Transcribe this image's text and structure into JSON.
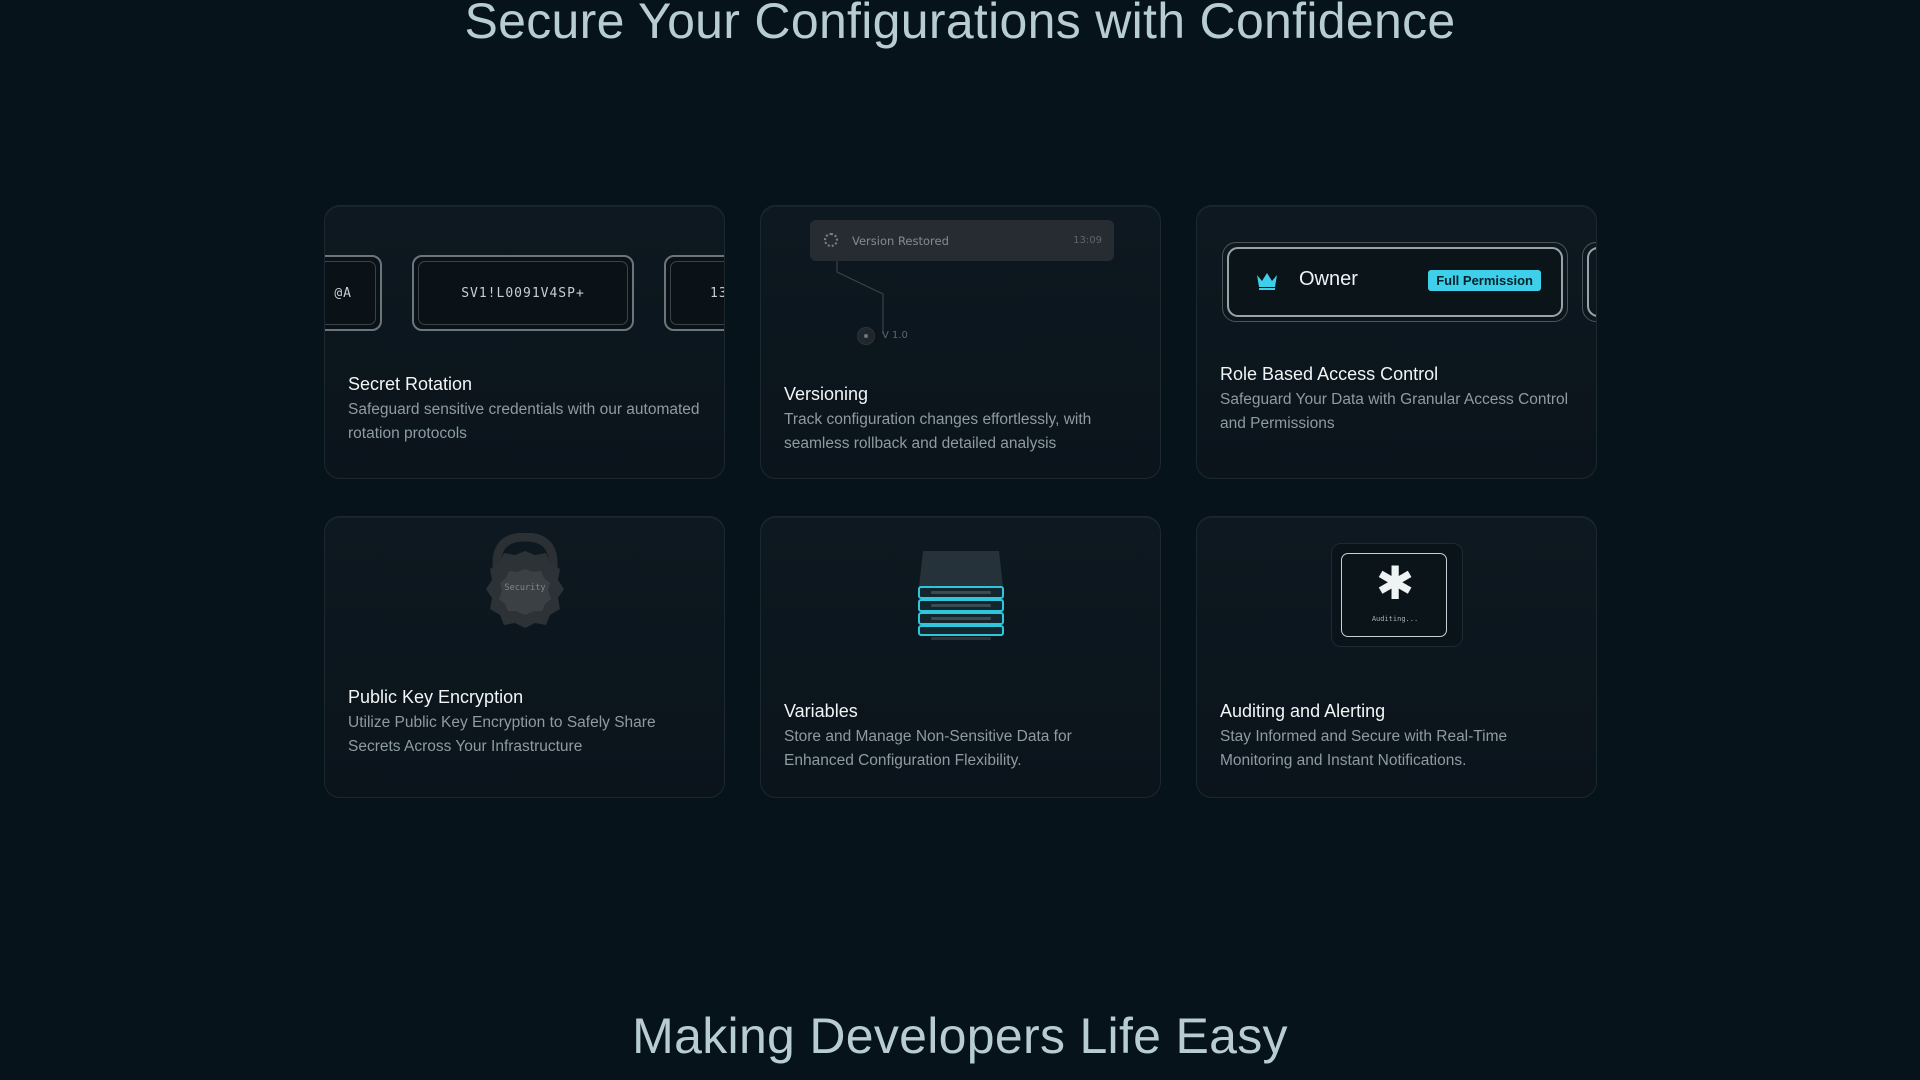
{
  "header": {
    "title": "Secure Your Configurations with Confidence"
  },
  "footer": {
    "title": "Making Developers Life Easy"
  },
  "cards": [
    {
      "title": "Secret Rotation",
      "description": "Safeguard sensitive credentials with our automated rotation protocols",
      "secrets": [
        "@A",
        "SV1!L0091V4SP+",
        "13"
      ]
    },
    {
      "title": "Versioning",
      "description": "Track configuration changes effortlessly, with seamless rollback and detailed analysis",
      "status": "Version Restored",
      "time": "13:09",
      "version": "V 1.0"
    },
    {
      "title": "Role Based Access Control",
      "description": "Safeguard Your Data with Granular Access Control and Permissions",
      "role": "Owner",
      "badge": "Full Permission"
    },
    {
      "title": "Public Key Encryption",
      "description": "Utilize Public Key Encryption to Safely Share Secrets Across Your Infrastructure",
      "lock_label": "Security"
    },
    {
      "title": "Variables",
      "description": "Store and Manage Non-Sensitive Data for Enhanced Configuration Flexibility."
    },
    {
      "title": "Auditing and Alerting",
      "description": "Stay Informed and Secure with Real-Time Monitoring and Instant Notifications.",
      "audit_label": "Auditing..."
    }
  ],
  "colors": {
    "accent": "#3ed0ea",
    "background": "#06131a",
    "card": "#0d1820"
  },
  "icons": [
    "spinner-icon",
    "crown-icon",
    "lock-icon",
    "stack-icon",
    "asterisk-icon"
  ]
}
